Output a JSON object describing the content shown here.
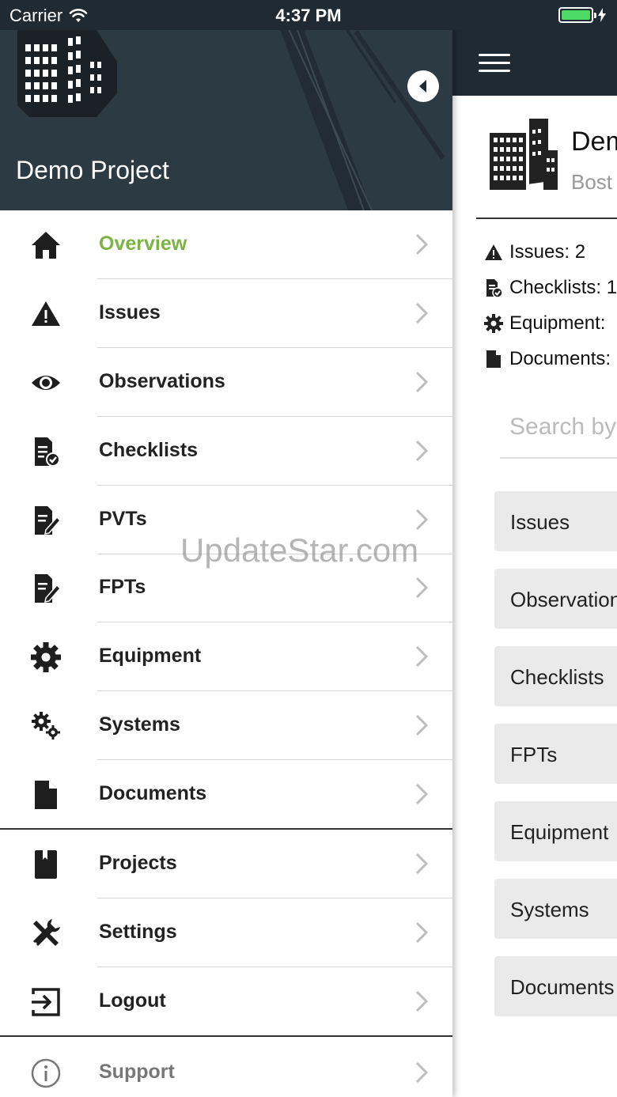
{
  "status_bar": {
    "carrier": "Carrier",
    "time": "4:37 PM"
  },
  "drawer": {
    "project_name": "Demo Project",
    "menu": [
      {
        "label": "Overview",
        "icon": "home-icon",
        "active": true
      },
      {
        "label": "Issues",
        "icon": "warning-icon"
      },
      {
        "label": "Observations",
        "icon": "eye-icon"
      },
      {
        "label": "Checklists",
        "icon": "checklist-icon"
      },
      {
        "label": "PVTs",
        "icon": "edit-document-icon"
      },
      {
        "label": "FPTs",
        "icon": "edit-document-icon"
      },
      {
        "label": "Equipment",
        "icon": "gear-icon"
      },
      {
        "label": "Systems",
        "icon": "gears-icon"
      },
      {
        "label": "Documents",
        "icon": "document-icon"
      },
      {
        "label": "Projects",
        "icon": "bookmark-icon"
      },
      {
        "label": "Settings",
        "icon": "tools-icon"
      },
      {
        "label": "Logout",
        "icon": "logout-icon"
      },
      {
        "label": "Support",
        "icon": "info-icon"
      }
    ]
  },
  "main": {
    "project_title": "Dem",
    "project_subtitle": "Bost",
    "stats": {
      "issues": "Issues: 2",
      "checklists": "Checklists: 1",
      "equipment": "Equipment:",
      "documents": "Documents:"
    },
    "search_placeholder": "Search by",
    "quick_links": [
      "Issues",
      "Observations",
      "Checklists",
      "FPTs",
      "Equipment",
      "Systems",
      "Documents"
    ]
  },
  "watermark": "UpdateStar.com",
  "colors": {
    "header": "#2c3a44",
    "topbar": "#1f2a33",
    "accent": "#7cb342",
    "battery": "#4cd964"
  }
}
